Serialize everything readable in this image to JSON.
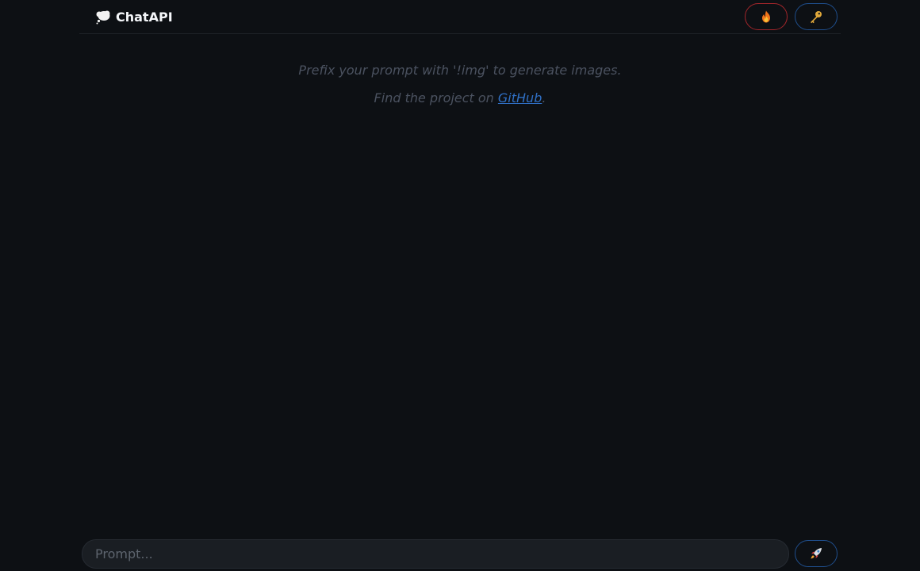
{
  "header": {
    "brand_name": "ChatAPI",
    "brand_icon": "thought-bubble-icon",
    "actions": [
      {
        "name": "clear-button",
        "icon": "fire-icon",
        "border_color": "#a3262b"
      },
      {
        "name": "api-key-button",
        "icon": "key-icon",
        "border_color": "#1f4e8c"
      }
    ]
  },
  "intro": {
    "line1": "Prefix your prompt with '!img' to generate images.",
    "line2_prefix": "Find the project on ",
    "line2_link": "GitHub",
    "line2_suffix": "."
  },
  "composer": {
    "placeholder": "Prompt...",
    "value": "",
    "send_icon": "rocket-icon"
  },
  "colors": {
    "background": "#0d1014",
    "intro_text": "#4b5260",
    "link": "#2f6fc4",
    "input_bg": "#1a1e23"
  }
}
